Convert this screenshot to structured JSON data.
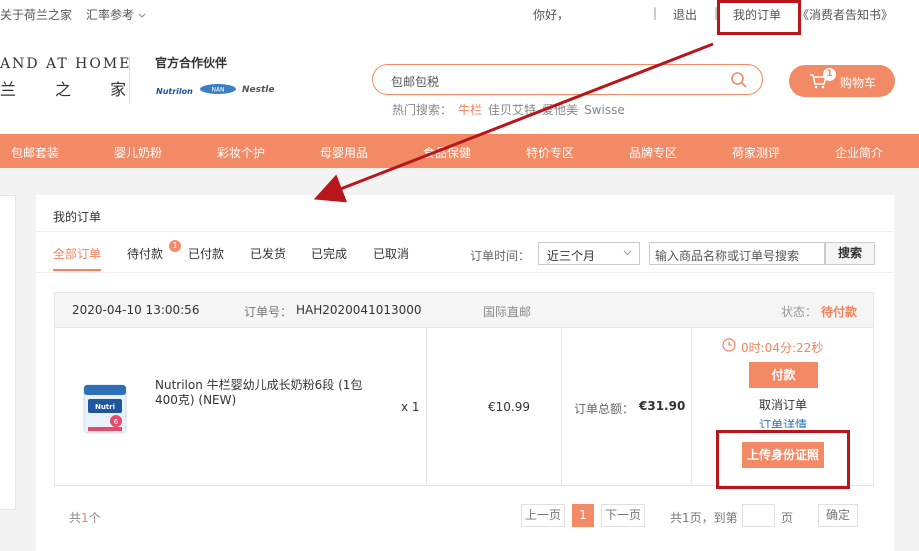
{
  "topbar": {
    "about": "关于荷兰之家",
    "rate": "汇率参考",
    "greeting": "你好，",
    "divider": "|",
    "logout": "退出",
    "my_orders": "我的订单",
    "consumer_notice": "《消费者告知书》"
  },
  "logo": {
    "en": "AND AT HOME",
    "cn": "兰 之 家"
  },
  "partners": {
    "title": "官方合作伙伴",
    "brands": [
      "Nutrilon",
      "Nestle"
    ]
  },
  "search": {
    "value": "包邮包税",
    "hot_label": "热门搜索：",
    "hot": [
      "牛栏",
      "佳贝艾特",
      "爱他美",
      "Swisse"
    ]
  },
  "cart": {
    "count": "1",
    "label": "购物车"
  },
  "nav": [
    "包邮套装",
    "婴儿奶粉",
    "彩妆个护",
    "母婴用品",
    "食品保健",
    "特价专区",
    "品牌专区",
    "荷家测评",
    "企业简介"
  ],
  "orders": {
    "title": "我的订单",
    "tabs": [
      "全部订单",
      "待付款",
      "已付款",
      "已发货",
      "已完成",
      "已取消"
    ],
    "pending_badge": "1",
    "time_label": "订单时间：",
    "time_value": "近三个月",
    "search_placeholder": "输入商品名称或订单号搜索",
    "search_button": "搜索"
  },
  "order": {
    "date": "2020-04-10 13:00:56",
    "number_label": "订单号：",
    "number": "HAH2020041013000",
    "shipping": "国际直邮",
    "status_label": "状态：",
    "status": "待付款",
    "product_name": "Nutrilon 牛栏婴幼儿成长奶粉6段 (1包400克) (NEW)",
    "qty": "x 1",
    "price": "€10.99",
    "total_label": "订单总额：",
    "total": "€31.90",
    "timer": "0时:04分:22秒",
    "pay": "付款",
    "cancel": "取消订单",
    "detail": "订单详情",
    "upload": "上传身份证照"
  },
  "pagination": {
    "total_prefix": "共",
    "total_count": "1",
    "total_suffix": "个",
    "prev": "上一页",
    "current": "1",
    "next": "下一页",
    "pages_text": "共1页，到第",
    "page_unit": "页",
    "confirm": "确定"
  },
  "colors": {
    "accent": "#f28a66",
    "annotation": "#b9161c"
  }
}
